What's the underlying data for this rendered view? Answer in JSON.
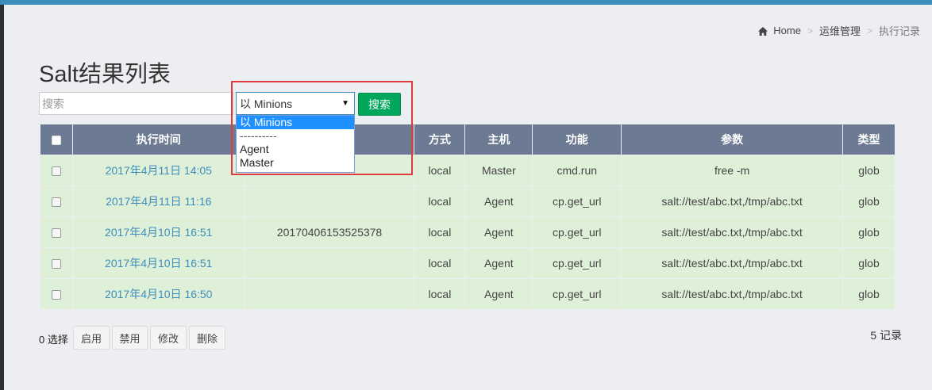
{
  "breadcrumb": {
    "home": "Home",
    "level2": "运维管理",
    "current": "执行记录"
  },
  "page_title": "Salt结果列表",
  "search": {
    "placeholder": "搜索",
    "value": ""
  },
  "target_select": {
    "value": "以 Minions",
    "options": [
      "以 Minions",
      "----------",
      "Agent",
      "Master"
    ],
    "selected_index": 0
  },
  "search_button": "搜索",
  "table": {
    "headers": {
      "time": "执行时间",
      "jid": "",
      "method": "方式",
      "host": "主机",
      "function": "功能",
      "args": "参数",
      "type": "类型"
    },
    "rows": [
      {
        "time": "2017年4月11日 14:05",
        "jid": "",
        "method": "local",
        "host": "Master",
        "function": "cmd.run",
        "args": "free -m",
        "type": "glob"
      },
      {
        "time": "2017年4月11日 11:16",
        "jid": "",
        "method": "local",
        "host": "Agent",
        "function": "cp.get_url",
        "args": "salt://test/abc.txt,/tmp/abc.txt",
        "type": "glob"
      },
      {
        "time": "2017年4月10日 16:51",
        "jid": "20170406153525378",
        "method": "local",
        "host": "Agent",
        "function": "cp.get_url",
        "args": "salt://test/abc.txt,/tmp/abc.txt",
        "type": "glob"
      },
      {
        "time": "2017年4月10日 16:51",
        "jid": "",
        "method": "local",
        "host": "Agent",
        "function": "cp.get_url",
        "args": "salt://test/abc.txt,/tmp/abc.txt",
        "type": "glob"
      },
      {
        "time": "2017年4月10日 16:50",
        "jid": "",
        "method": "local",
        "host": "Agent",
        "function": "cp.get_url",
        "args": "salt://test/abc.txt,/tmp/abc.txt",
        "type": "glob"
      }
    ]
  },
  "footer": {
    "selected_count": "0 选择",
    "actions": {
      "enable": "启用",
      "disable": "禁用",
      "edit": "修改",
      "delete": "删除"
    },
    "records": "5 记录"
  },
  "colors": {
    "accent": "#3c8dbc",
    "success": "#00a65a",
    "table_header": "#6c7b93",
    "row_bg": "#dff0d8",
    "highlight": "#e0393e"
  }
}
